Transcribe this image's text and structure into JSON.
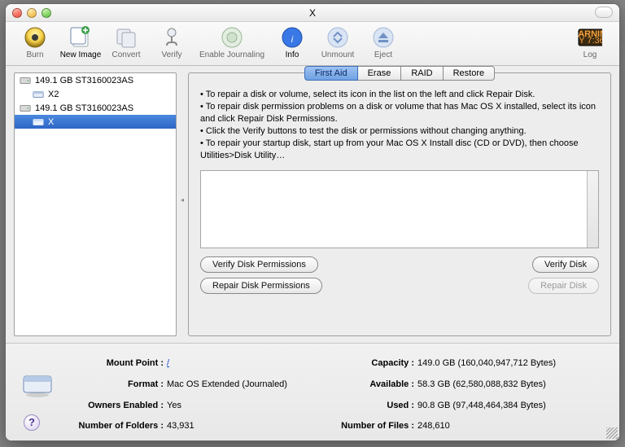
{
  "window": {
    "title": "X"
  },
  "toolbar": {
    "burn": "Burn",
    "newimage": "New Image",
    "convert": "Convert",
    "verify": "Verify",
    "journal": "Enable Journaling",
    "info": "Info",
    "unmount": "Unmount",
    "eject": "Eject",
    "log": "Log"
  },
  "sidebar": {
    "items": [
      {
        "label": "149.1 GB ST3160023AS"
      },
      {
        "label": "X2"
      },
      {
        "label": "149.1 GB ST3160023AS"
      },
      {
        "label": "X"
      }
    ]
  },
  "tabs": {
    "firstaid": "First Aid",
    "erase": "Erase",
    "raid": "RAID",
    "restore": "Restore"
  },
  "instructions": {
    "l1": "• To repair a disk or volume, select its icon in the list on the left and click Repair Disk.",
    "l2": "• To repair disk permission problems on a disk or volume that has Mac OS X installed, select its icon and click Repair Disk Permissions.",
    "l3": "• Click the Verify buttons to test the disk or permissions without changing anything.",
    "l4": "• To repair your startup disk, start up from your Mac OS X Install disc (CD or DVD), then choose Utilities>Disk Utility…"
  },
  "buttons": {
    "verifyperm": "Verify Disk Permissions",
    "verifydisk": "Verify Disk",
    "repairperm": "Repair Disk Permissions",
    "repairdisk": "Repair Disk"
  },
  "footer": {
    "left": {
      "mountpoint_k": "Mount Point :",
      "mountpoint_v": "/",
      "format_k": "Format :",
      "format_v": "Mac OS Extended (Journaled)",
      "owners_k": "Owners Enabled :",
      "owners_v": "Yes",
      "folders_k": "Number of Folders :",
      "folders_v": "43,931"
    },
    "right": {
      "capacity_k": "Capacity :",
      "capacity_v": "149.0 GB (160,040,947,712 Bytes)",
      "available_k": "Available :",
      "available_v": "58.3 GB (62,580,088,832 Bytes)",
      "used_k": "Used :",
      "used_v": "90.8 GB (97,448,464,384 Bytes)",
      "files_k": "Number of Files :",
      "files_v": "248,610"
    }
  }
}
